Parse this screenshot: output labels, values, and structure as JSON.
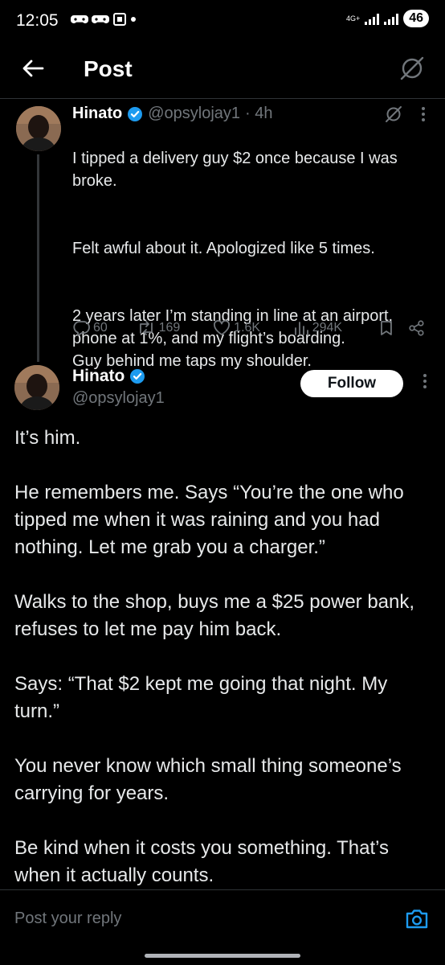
{
  "status_bar": {
    "time": "12:05",
    "network": "4G+",
    "battery": "46"
  },
  "header": {
    "title": "Post"
  },
  "parent_tweet": {
    "author_name": "Hinato",
    "handle": "@opsylojay1",
    "time": "· 4h",
    "paragraphs": [
      "I tipped a delivery guy $2 once because I was broke.",
      "Felt awful about it. Apologized like 5 times.",
      "2 years later I’m standing in line at an airport, phone at 1%, and my flight’s boarding.\nGuy behind me taps my shoulder."
    ],
    "stats": {
      "replies": "60",
      "reposts": "169",
      "likes": "1.6K",
      "views": "294K"
    }
  },
  "main_tweet": {
    "author_name": "Hinato",
    "handle": "@opsylojay1",
    "follow_label": "Follow",
    "paragraphs": [
      "It’s him.",
      "He remembers me. Says “You’re the one who tipped me when it was raining and you had nothing. Let me grab you a charger.”",
      "Walks to the shop, buys me a $25 power bank, refuses to let me pay him back.",
      "Says: “That $2 kept me going that night. My turn.”",
      "You never know which small thing someone’s carrying for years.",
      "Be kind when it costs you something. That’s when it actually counts."
    ]
  },
  "reply": {
    "placeholder": "Post your reply"
  },
  "colors": {
    "background": "#000000",
    "text": "#e7e9ea",
    "muted": "#71767b",
    "verified": "#1d9bf0",
    "camera": "#1d9bf0"
  }
}
